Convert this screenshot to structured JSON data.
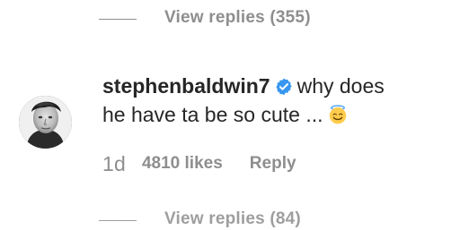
{
  "thread": {
    "top_view_replies": "View replies (355)",
    "bottom_view_replies": "View replies (84)"
  },
  "comment": {
    "username": "stephenbaldwin7",
    "text_line_1": "why does",
    "text_line_2": "he have ta be so cute ...",
    "time": "1d",
    "likes": "4810 likes",
    "reply": "Reply",
    "badge_icon": "verified-check-icon",
    "emoji_icon": "smiling-face-with-halo-icon",
    "avatar_icon": "avatar-photo"
  },
  "colors": {
    "text_primary": "#262626",
    "text_muted": "#8e8e8e",
    "verified_blue": "#3897f0",
    "emoji_yellow": "#ffcc4d"
  }
}
